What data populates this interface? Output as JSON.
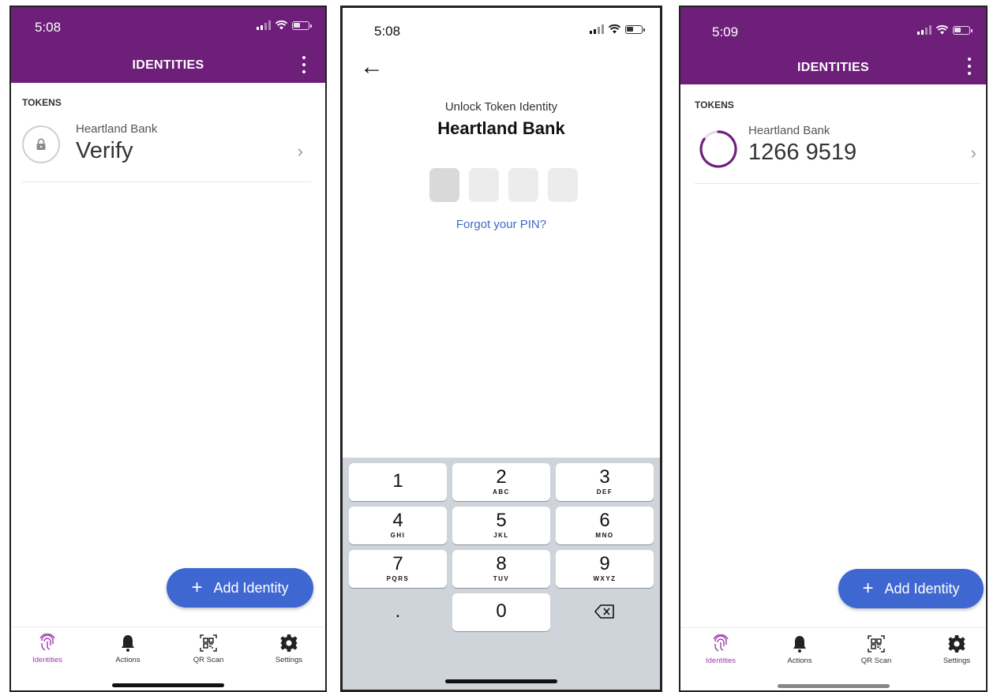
{
  "screen1": {
    "status_time": "5:08",
    "header_title": "IDENTITIES",
    "section_label": "TOKENS",
    "token": {
      "bank": "Heartland Bank",
      "value": "Verify",
      "state": "locked",
      "icon": "lock-icon"
    },
    "fab_label": "Add Identity",
    "tabs": [
      {
        "label": "Identities",
        "icon": "fingerprint-icon",
        "active": true
      },
      {
        "label": "Actions",
        "icon": "bell-icon",
        "active": false
      },
      {
        "label": "QR Scan",
        "icon": "qr-scan-icon",
        "active": false
      },
      {
        "label": "Settings",
        "icon": "gear-icon",
        "active": false
      }
    ]
  },
  "screen2": {
    "status_time": "5:08",
    "subtitle": "Unlock Token Identity",
    "title": "Heartland Bank",
    "pin_length": 4,
    "forgot_link": "Forgot your PIN?",
    "keys": [
      {
        "digit": "1",
        "letters": ""
      },
      {
        "digit": "2",
        "letters": "ABC"
      },
      {
        "digit": "3",
        "letters": "DEF"
      },
      {
        "digit": "4",
        "letters": "GHI"
      },
      {
        "digit": "5",
        "letters": "JKL"
      },
      {
        "digit": "6",
        "letters": "MNO"
      },
      {
        "digit": "7",
        "letters": "PQRS"
      },
      {
        "digit": "8",
        "letters": "TUV"
      },
      {
        "digit": "9",
        "letters": "WXYZ"
      },
      {
        "digit": ".",
        "letters": ""
      },
      {
        "digit": "0",
        "letters": ""
      }
    ]
  },
  "screen3": {
    "status_time": "5:09",
    "header_title": "IDENTITIES",
    "section_label": "TOKENS",
    "token": {
      "bank": "Heartland Bank",
      "value": "1266 9519",
      "state": "unlocked",
      "icon": "timer-ring-icon"
    },
    "fab_label": "Add Identity",
    "tabs": [
      {
        "label": "Identities",
        "icon": "fingerprint-icon",
        "active": true
      },
      {
        "label": "Actions",
        "icon": "bell-icon",
        "active": false
      },
      {
        "label": "QR Scan",
        "icon": "qr-scan-icon",
        "active": false
      },
      {
        "label": "Settings",
        "icon": "gear-icon",
        "active": false
      }
    ]
  },
  "colors": {
    "header": "#6e1f7a",
    "fab": "#3f67d1",
    "link": "#3e6ac9",
    "tab_active": "#9b3aa8",
    "keypad_bg": "#cfd3da"
  }
}
